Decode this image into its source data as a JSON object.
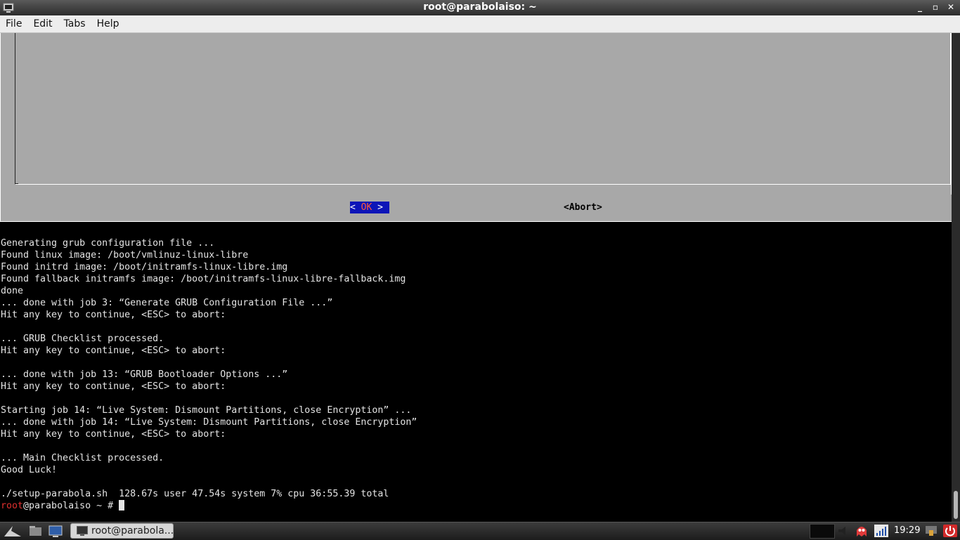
{
  "window": {
    "title": "root@parabolaiso: ~"
  },
  "menu": [
    "File",
    "Edit",
    "Tabs",
    "Help"
  ],
  "dialog": {
    "ok_label": " OK ",
    "ok_left": "<",
    "ok_right": ">",
    "abort_label": "<Abort>"
  },
  "terminal": {
    "lines": [
      "Generating grub configuration file ...",
      "Found linux image: /boot/vmlinuz-linux-libre",
      "Found initrd image: /boot/initramfs-linux-libre.img",
      "Found fallback initramfs image: /boot/initramfs-linux-libre-fallback.img",
      "done",
      "... done with job 3: “Generate GRUB Configuration File ...”",
      "Hit any key to continue, <ESC> to abort:",
      "",
      "... GRUB Checklist processed.",
      "Hit any key to continue, <ESC> to abort:",
      "",
      "... done with job 13: “GRUB Bootloader Options ...”",
      "Hit any key to continue, <ESC> to abort:",
      "",
      "Starting job 14: “Live System: Dismount Partitions, close Encryption” ...",
      "... done with job 14: “Live System: Dismount Partitions, close Encryption”",
      "Hit any key to continue, <ESC> to abort:",
      "",
      "... Main Checklist processed.",
      "Good Luck!",
      "",
      "./setup-parabola.sh  128.67s user 47.54s system 7% cpu 36:55.39 total"
    ],
    "prompt_user": "root",
    "prompt_rest": "@parabolaiso ~ # "
  },
  "taskbar": {
    "task_label": "root@parabola...",
    "clock": "19:29"
  },
  "colors": {
    "ok_bg": "#0d15b8",
    "ok_text": "#ff5a3a",
    "prompt_user": "#e0302e"
  }
}
